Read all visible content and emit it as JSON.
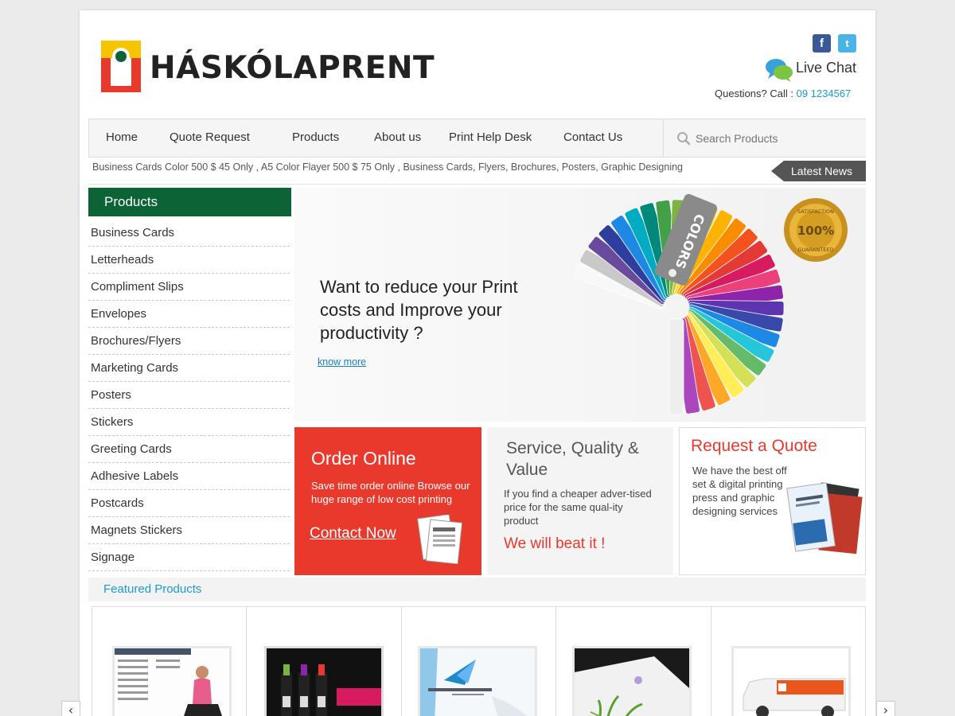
{
  "brand": {
    "name": "HÁSKÓLAPRENT",
    "accent": "#0c6335",
    "red": "#e8392c",
    "yellow": "#f6c400",
    "link": "#1a9ad6"
  },
  "header": {
    "social": {
      "facebook_glyph": "f",
      "twitter_glyph": "t"
    },
    "live_chat": "Live Chat",
    "call_label": "Questions? Call : ",
    "call_number": "09 1234567"
  },
  "nav": {
    "items": [
      "Home",
      "Quote Request",
      "Products",
      "About us",
      "Print Help Desk",
      "Contact Us"
    ],
    "search_placeholder": "Search Products"
  },
  "ticker": {
    "text": "Business Cards Color 500 $ 45 Only ,   A5 Color Flayer 500 $ 75 Only , Business Cards, Flyers, Brochures, Posters, Graphic Designing",
    "latest_label": "Latest News"
  },
  "sidebar": {
    "title": "Products",
    "items": [
      "Business Cards",
      "Letterheads",
      "Compliment Slips",
      "Envelopes",
      "Brochures/Flyers",
      "Marketing Cards",
      "Posters",
      "Stickers",
      "Greeting Cards",
      "Adhesive Labels",
      "Postcards",
      "Magnets Stickers",
      "Signage"
    ]
  },
  "banner": {
    "headline": "Want to reduce your Print costs and Improve your productivity ?",
    "link": "know more",
    "fan_label": "COLORS",
    "seal_top": "SATISFACTION",
    "seal_value": "100%",
    "seal_bottom": "GUARANTEED"
  },
  "boxes": {
    "order": {
      "title": "Order Online",
      "desc": "Save time order online Browse our huge range of low cost printing",
      "link": "Contact Now"
    },
    "service": {
      "title": "Service, Quality & Value",
      "desc": "If you find a cheaper adver-tised price for the same qual-ity product",
      "highlight": "We will beat it !"
    },
    "quote": {
      "title": "Request a  Quote",
      "desc": "We have the best off set & digital printing press and graphic designing services"
    }
  },
  "featured": {
    "title": "Featured Products",
    "items": [
      "brochure-spread",
      "wine-bottles",
      "rocket-multimedia-card",
      "floral-card",
      "branded-van"
    ],
    "prev_glyph": "‹",
    "next_glyph": "›"
  }
}
